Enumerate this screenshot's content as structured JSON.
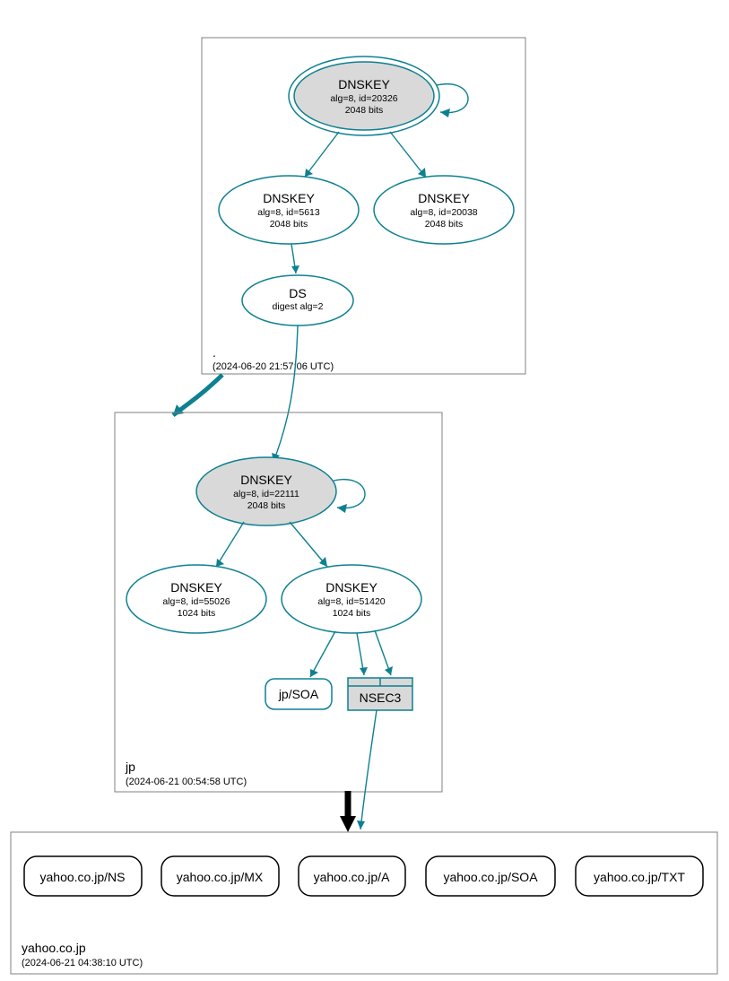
{
  "zones": {
    "root": {
      "label": ".",
      "timestamp": "(2024-06-20 21:57:06 UTC)",
      "nodes": {
        "ksk": {
          "title": "DNSKEY",
          "line1": "alg=8, id=20326",
          "line2": "2048 bits"
        },
        "zsk1": {
          "title": "DNSKEY",
          "line1": "alg=8, id=5613",
          "line2": "2048 bits"
        },
        "zsk2": {
          "title": "DNSKEY",
          "line1": "alg=8, id=20038",
          "line2": "2048 bits"
        },
        "ds": {
          "title": "DS",
          "line1": "digest alg=2"
        }
      }
    },
    "jp": {
      "label": "jp",
      "timestamp": "(2024-06-21 00:54:58 UTC)",
      "nodes": {
        "ksk": {
          "title": "DNSKEY",
          "line1": "alg=8, id=22111",
          "line2": "2048 bits"
        },
        "zsk1": {
          "title": "DNSKEY",
          "line1": "alg=8, id=55026",
          "line2": "1024 bits"
        },
        "zsk2": {
          "title": "DNSKEY",
          "line1": "alg=8, id=51420",
          "line2": "1024 bits"
        },
        "soa": {
          "label": "jp/SOA"
        },
        "nsec3": {
          "label": "NSEC3"
        }
      }
    },
    "yahoo": {
      "label": "yahoo.co.jp",
      "timestamp": "(2024-06-21 04:38:10 UTC)",
      "records": {
        "ns": "yahoo.co.jp/NS",
        "mx": "yahoo.co.jp/MX",
        "a": "yahoo.co.jp/A",
        "soa": "yahoo.co.jp/SOA",
        "txt": "yahoo.co.jp/TXT"
      }
    }
  }
}
